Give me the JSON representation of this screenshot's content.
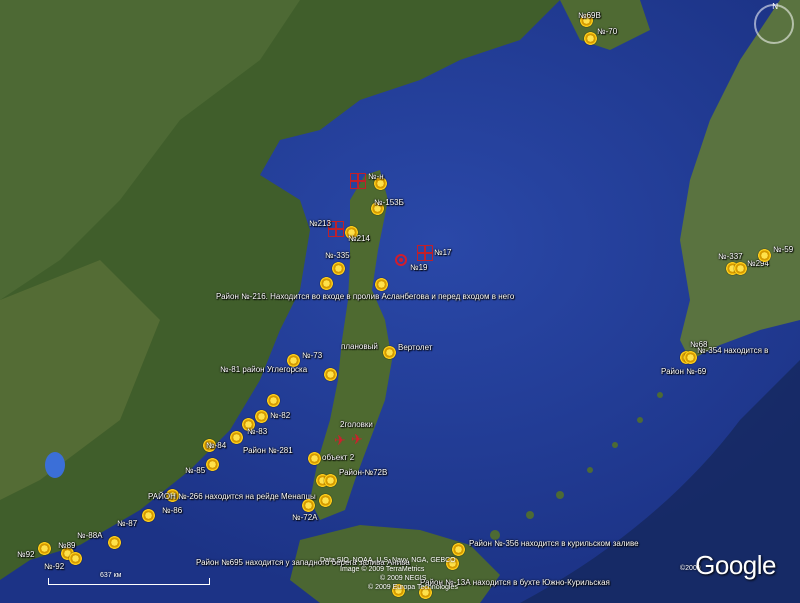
{
  "map": {
    "colors": {
      "sea": "#233f9e",
      "deep": "#1b2f7e",
      "land": "#3f5e2c",
      "land2": "#5b6b3a",
      "marker": "#f6c21a",
      "red": "#d21d2c"
    },
    "markers": [
      {
        "label": "№69В"
      },
      {
        "label": "№-70"
      },
      {
        "label": "№-н"
      },
      {
        "label": "№-153Б"
      },
      {
        "label": "№213"
      },
      {
        "label": "№214"
      },
      {
        "label": "№-335"
      },
      {
        "label": "№17"
      },
      {
        "label": "№19"
      },
      {
        "label": "Район №-216. Находится во входе в пролив Асланбегова и перед входом в него"
      },
      {
        "label": "плановый"
      },
      {
        "label": "Вертолет"
      },
      {
        "label": "№-73"
      },
      {
        "label": "№-81 район Углегорска"
      },
      {
        "label": "№-82"
      },
      {
        "label": "№-83"
      },
      {
        "label": "№-84"
      },
      {
        "label": "Район №-281"
      },
      {
        "label": "№-85"
      },
      {
        "label": "2головки"
      },
      {
        "label": "объект 2"
      },
      {
        "label": "Район-№72В"
      },
      {
        "label": "РАЙОН №-266 находится на рейде Менапцы"
      },
      {
        "label": "№-86"
      },
      {
        "label": "№-72А"
      },
      {
        "label": "№-87"
      },
      {
        "label": "№-88А"
      },
      {
        "label": "№89"
      },
      {
        "label": "№92"
      },
      {
        "label": "№-92"
      },
      {
        "label": "Район №-356 находится в курильском заливе"
      },
      {
        "label": "Район №695 находится у западного берега залива Анива"
      },
      {
        "label": "Район №-13А находится в бухте Южно-Курильская"
      },
      {
        "label": "№-337"
      },
      {
        "label": "№294"
      },
      {
        "label": "№-59"
      },
      {
        "label": "№68"
      },
      {
        "label": "№-354 находится в"
      },
      {
        "label": "Район №-69"
      }
    ],
    "credits": [
      "Data SIO, NOAA, U.S. Navy, NGA, GEBCO",
      "Image © 2009 TerraMetrics",
      "© 2009 NEGIS",
      "© 2009 Europa Technologies"
    ],
    "year": "©2009",
    "brand": "Google",
    "scale_label": "637 км",
    "compass": "N"
  }
}
